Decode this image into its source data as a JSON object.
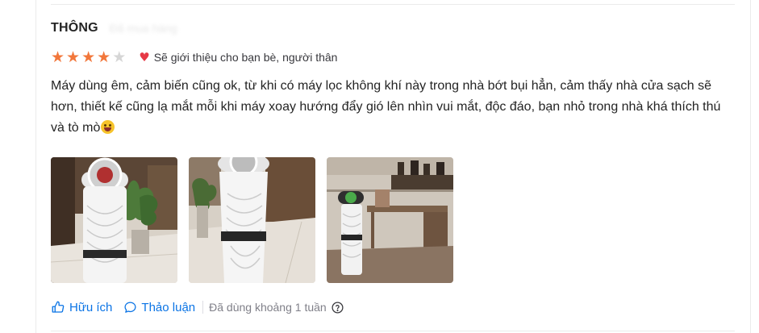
{
  "review": {
    "reviewer_name": "THÔNG",
    "reviewer_meta_blurred": "Đã mua hàng",
    "rating": 4,
    "rating_max": 5,
    "recommend_text": "Sẽ giới thiệu cho bạn bè, người thân",
    "comment": "Máy dùng êm, cảm biến cũng ok, từ khi có máy lọc không khí này trong nhà bớt bụi hẳn, cảm thấy nhà cửa sạch sẽ hơn, thiết kế cũng lạ mắt mỗi khi máy xoay hướng đẩy gió lên nhìn vui mắt, độc đáo, bạn nhỏ trong nhà khá thích thú và tò mò",
    "emoji_icon": "grinning-face-emoji",
    "photos": [
      {
        "name": "review-photo-1",
        "subject": "air-purifier-with-plant"
      },
      {
        "name": "review-photo-2",
        "subject": "air-purifier-closeup"
      },
      {
        "name": "review-photo-3",
        "subject": "air-purifier-in-room"
      }
    ]
  },
  "actions": {
    "helpful_label": "Hữu ích",
    "discuss_label": "Thảo luận",
    "used_duration": "Đã dùng khoảng 1 tuần"
  },
  "colors": {
    "star_active": "#f2773b",
    "star_inactive": "#d6d6d6",
    "heart": "#e63946",
    "link": "#0b74e5",
    "muted_text": "#808089",
    "body_text": "#242424"
  }
}
